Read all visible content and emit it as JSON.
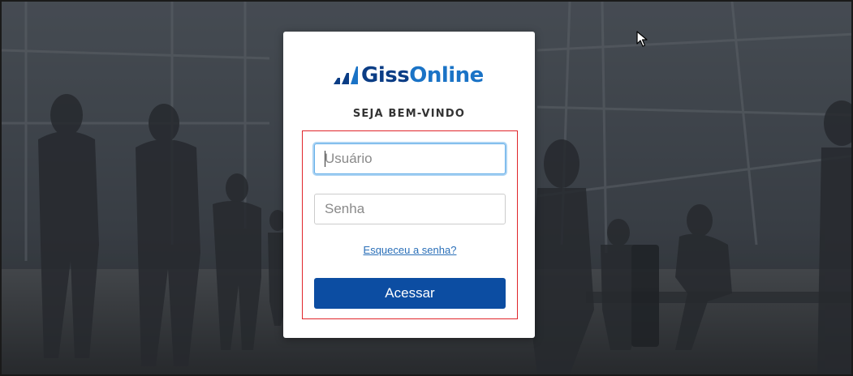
{
  "brand": {
    "logo_part1": "Giss",
    "logo_part2": "Online",
    "primary_color": "#0b3d85",
    "secondary_color": "#1a73c6"
  },
  "login": {
    "welcome": "SEJA BEM-VINDO",
    "username_placeholder": "Usuário",
    "password_placeholder": "Senha",
    "forgot_link": "Esqueceu a senha?",
    "submit_label": "Acessar",
    "submit_color": "#0c4da2",
    "highlight_color": "#e0252a"
  },
  "icons": {
    "logo_mark": "bar-steps-icon",
    "pointer": "mouse-cursor-icon"
  }
}
